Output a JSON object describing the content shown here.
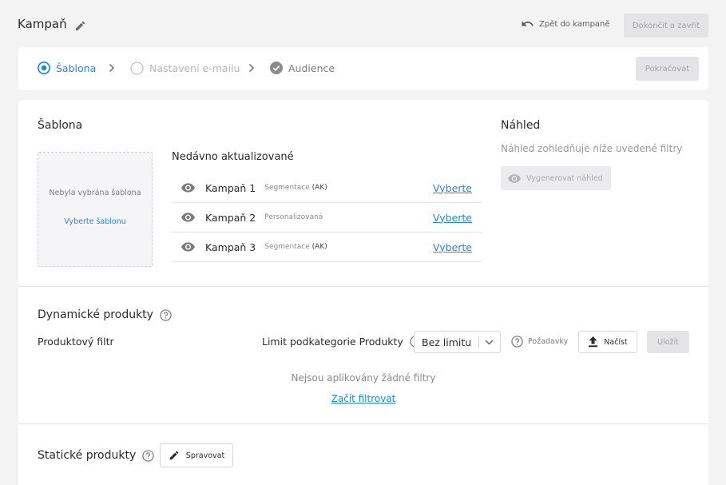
{
  "header": {
    "title": "Kampaň",
    "back_label": "Zpět do kampaně",
    "finish_label": "Dokončit a zavřít"
  },
  "stepper": {
    "steps": [
      {
        "label": "Šablona",
        "state": "active"
      },
      {
        "label": "Nastavení e-mailu",
        "state": "inactive"
      },
      {
        "label": "Audience",
        "state": "done"
      }
    ],
    "continue_label": "Pokračovat"
  },
  "template": {
    "title": "Šablona",
    "empty_text": "Nebyla vybrána šablona",
    "pick_link": "Vyberte šablonu"
  },
  "recent": {
    "title": "Nedávno aktualizované",
    "items": [
      {
        "name": "Kampaň 1",
        "tag": "Segmentace",
        "tag_suffix": "(AK)",
        "action": "Vyberte"
      },
      {
        "name": "Kampaň 2",
        "tag": "Personalizovaná",
        "tag_suffix": "",
        "action": "Vyberte"
      },
      {
        "name": "Kampaň 3",
        "tag": "Segmentace",
        "tag_suffix": "(AK)",
        "action": "Vyberte"
      }
    ]
  },
  "preview": {
    "title": "Náhled",
    "description": "Náhled zohledňuje níže uvedené filtry",
    "generate_label": "Vygenerovat náhled"
  },
  "dynamic": {
    "title": "Dynamické produkty",
    "filter_label": "Produktový filtr",
    "limit_label": "Limit podkategorie Produkty",
    "limit_value": "Bez limitu",
    "requirements_label": "Požadavky",
    "load_label": "Načíst",
    "save_label": "Uložit",
    "no_filters": "Nejsou aplikovány žádné filtry",
    "start_filter": "Začít filtrovat"
  },
  "static": {
    "title": "Statické produkty",
    "manage_label": "Spravovat"
  },
  "colors": {
    "accent": "#1e88e5",
    "background": "#f3f3f4",
    "disabled_button": "#e4e4e6"
  }
}
